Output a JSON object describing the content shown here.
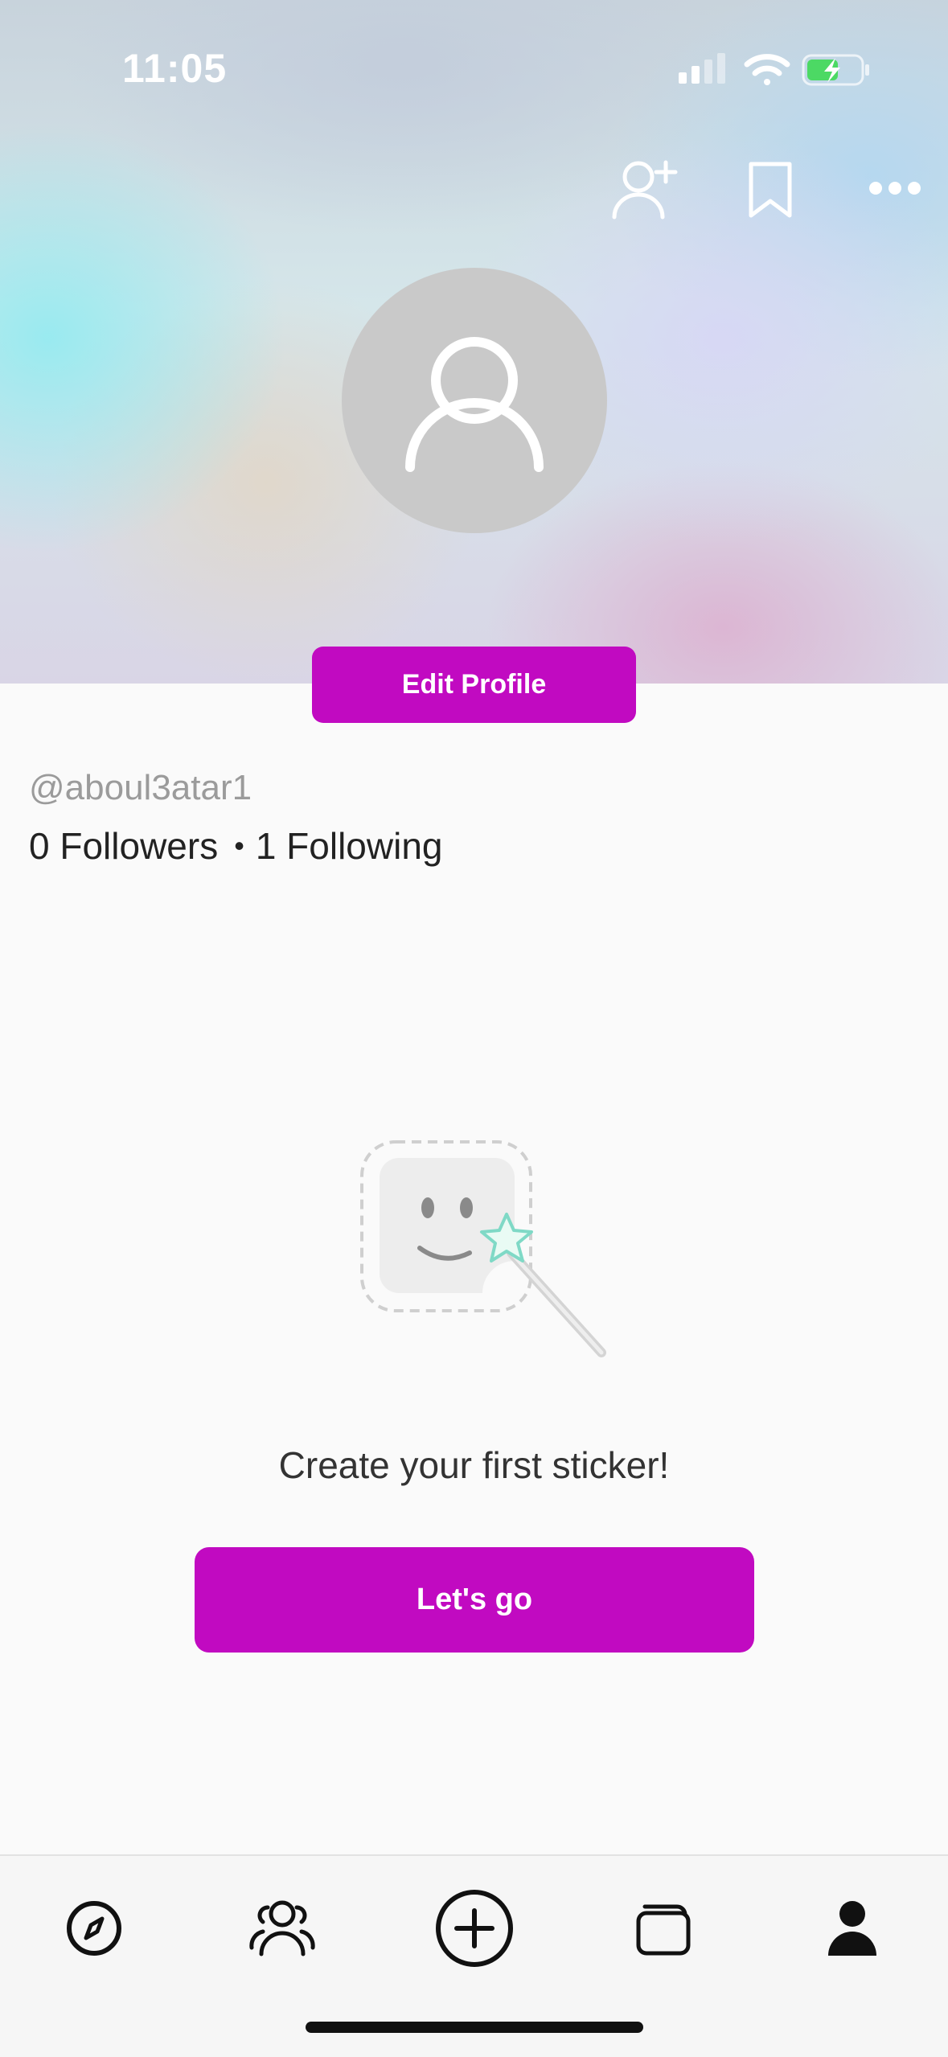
{
  "status_bar": {
    "time": "11:05"
  },
  "profile": {
    "edit_label": "Edit Profile",
    "username": "@aboul3atar1",
    "followers": "0 Followers",
    "separator": "•",
    "following": "1 Following"
  },
  "header_actions": [
    "add-user-icon",
    "bookmark-icon",
    "more-icon"
  ],
  "empty_state": {
    "message": "Create your first sticker!",
    "button_label": "Let's go"
  },
  "tabs": [
    "explore-icon",
    "community-icon",
    "create-icon",
    "collections-icon",
    "profile-icon"
  ],
  "colors": {
    "accent": "#c10ac1",
    "avatar_bg": "#c9c9c9"
  }
}
